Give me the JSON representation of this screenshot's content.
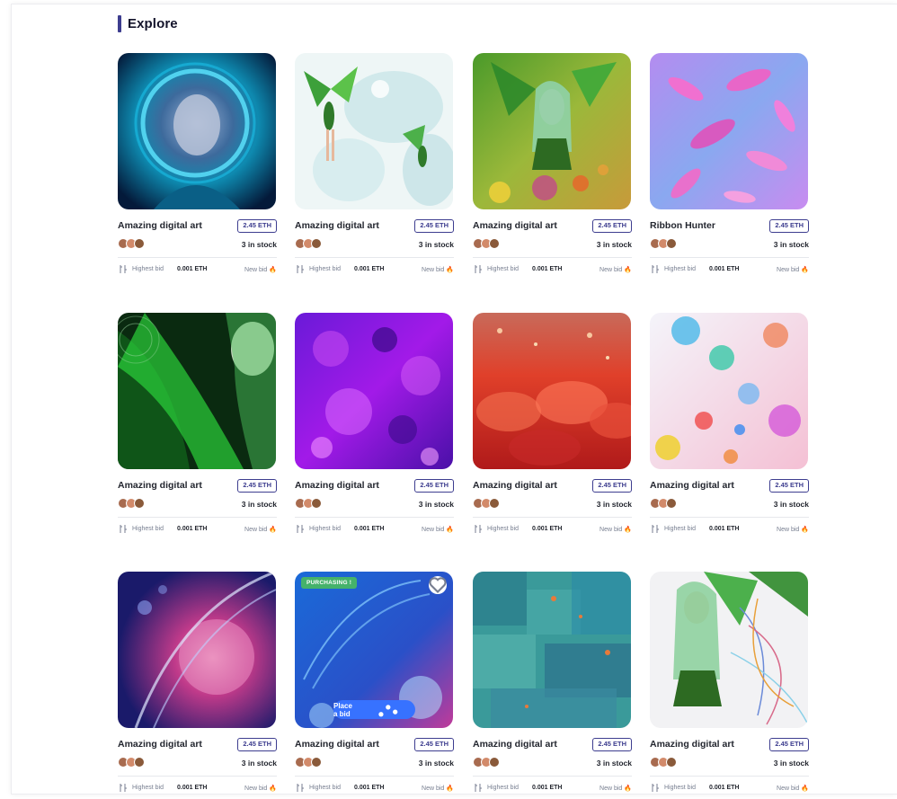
{
  "section": {
    "title": "Explore"
  },
  "colors": {
    "accent": "#3d3d8f",
    "purchasing": "#45b26b",
    "place_bid": "#3772ff",
    "fire": "#ff7a00"
  },
  "cards": [
    {
      "name": "Amazing digital art",
      "price": "2.45 ETH",
      "stock": "3 in stock",
      "bid_label": "Highest bid",
      "bid_value": "0.001 ETH",
      "new_bid": "New bid",
      "image": "woman-in-teal-portal"
    },
    {
      "name": "Amazing digital art",
      "price": "2.45 ETH",
      "stock": "3 in stock",
      "bid_label": "Highest bid",
      "bid_value": "0.001 ETH",
      "new_bid": "New bid",
      "image": "fairies-with-bubbles"
    },
    {
      "name": "Amazing digital art",
      "price": "2.45 ETH",
      "stock": "3 in stock",
      "bid_label": "Highest bid",
      "bid_value": "0.001 ETH",
      "new_bid": "New bid",
      "image": "green-fairy"
    },
    {
      "name": "Ribbon Hunter",
      "price": "2.45 ETH",
      "stock": "3 in stock",
      "bid_label": "Highest bid",
      "bid_value": "0.001 ETH",
      "new_bid": "New bid",
      "image": "pink-ribbons"
    },
    {
      "name": "Amazing digital art",
      "price": "2.45 ETH",
      "stock": "3 in stock",
      "bid_label": "Highest bid",
      "bid_value": "0.001 ETH",
      "new_bid": "New bid",
      "image": "green-wave-woman"
    },
    {
      "name": "Amazing digital art",
      "price": "2.45 ETH",
      "stock": "3 in stock",
      "bid_label": "Highest bid",
      "bid_value": "0.001 ETH",
      "new_bid": "New bid",
      "image": "purple-bubbles"
    },
    {
      "name": "Amazing digital art",
      "price": "2.45 ETH",
      "stock": "3 in stock",
      "bid_label": "Highest bid",
      "bid_value": "0.001 ETH",
      "new_bid": "New bid",
      "image": "red-bubbles"
    },
    {
      "name": "Amazing digital art",
      "price": "2.45 ETH",
      "stock": "3 in stock",
      "bid_label": "Highest bid",
      "bid_value": "0.001 ETH",
      "new_bid": "New bid",
      "image": "colorful-spheres"
    },
    {
      "name": "Amazing digital art",
      "price": "2.45 ETH",
      "stock": "3 in stock",
      "bid_label": "Highest bid",
      "bid_value": "0.001 ETH",
      "new_bid": "New bid",
      "image": "dna-cell"
    },
    {
      "name": "Amazing digital art",
      "price": "2.45 ETH",
      "stock": "3 in stock",
      "bid_label": "Highest bid",
      "bid_value": "0.001 ETH",
      "new_bid": "New bid",
      "image": "blue-dna-virus",
      "badge": "PURCHASING !",
      "place_bid": "Place a bid"
    },
    {
      "name": "Amazing digital art",
      "price": "2.45 ETH",
      "stock": "3 in stock",
      "bid_label": "Highest bid",
      "bid_value": "0.001 ETH",
      "new_bid": "New bid",
      "image": "teal-abstract"
    },
    {
      "name": "Amazing digital art",
      "price": "2.45 ETH",
      "stock": "3 in stock",
      "bid_label": "Highest bid",
      "bid_value": "0.001 ETH",
      "new_bid": "New bid",
      "image": "fairy-with-lines"
    }
  ]
}
